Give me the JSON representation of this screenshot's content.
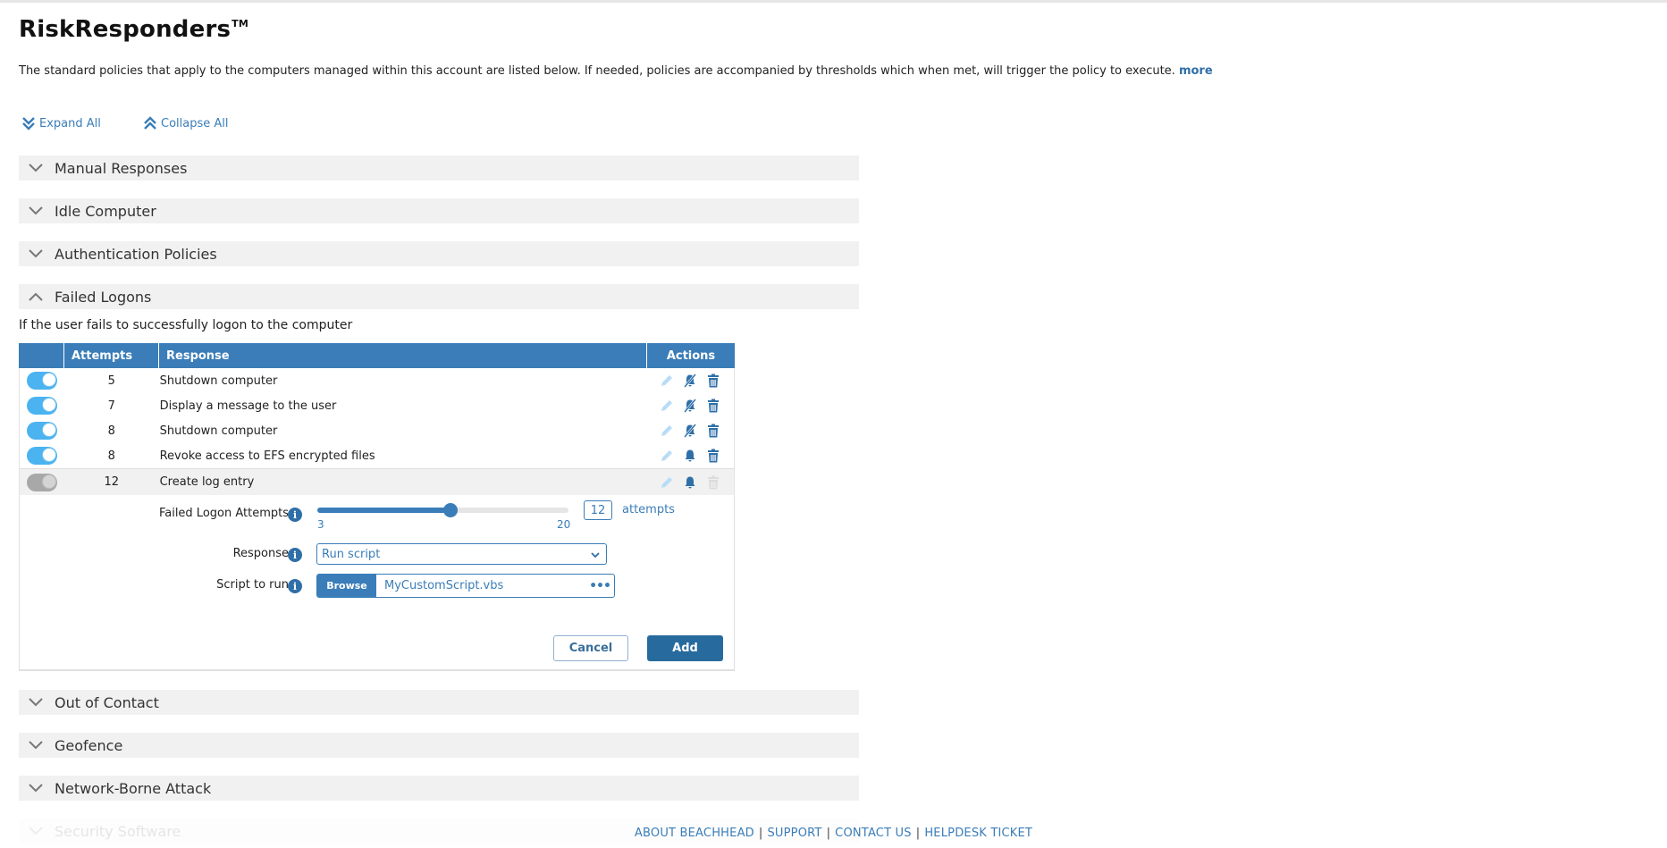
{
  "header": {
    "title": "RiskResponders",
    "trademark": "TM",
    "description": "The standard policies that apply to the computers managed within this account are listed below. If needed, policies are accompanied by thresholds which when met, will trigger the policy to execute.",
    "more_link": "more"
  },
  "controls": {
    "expand_all": "Expand All",
    "collapse_all": "Collapse All"
  },
  "sections": [
    {
      "label": "Manual Responses",
      "expanded": false
    },
    {
      "label": "Idle Computer",
      "expanded": false
    },
    {
      "label": "Authentication Policies",
      "expanded": false
    },
    {
      "label": "Failed Logons",
      "expanded": true
    },
    {
      "label": "Out of Contact",
      "expanded": false
    },
    {
      "label": "Geofence",
      "expanded": false
    },
    {
      "label": "Network-Borne Attack",
      "expanded": false
    },
    {
      "label": "Security Software",
      "expanded": false
    }
  ],
  "failed_logons": {
    "description": "If the user fails to successfully logon to the computer",
    "table": {
      "columns": [
        "",
        "Attempts",
        "Response",
        "Actions"
      ],
      "rows": [
        {
          "enabled": true,
          "attempts": "5",
          "response": "Shutdown computer",
          "notify": false
        },
        {
          "enabled": true,
          "attempts": "7",
          "response": "Display a message to the user",
          "notify": false
        },
        {
          "enabled": true,
          "attempts": "8",
          "response": "Shutdown computer",
          "notify": false
        },
        {
          "enabled": true,
          "attempts": "8",
          "response": "Revoke access to EFS encrypted files",
          "notify": true
        },
        {
          "enabled": false,
          "attempts": "12",
          "response": "Create log entry",
          "notify": true,
          "selected": true
        }
      ]
    },
    "form": {
      "attempts_label": "Failed Logon Attempts",
      "slider": {
        "min": 3,
        "max": 20,
        "value": 12,
        "min_label": "3",
        "max_label": "20"
      },
      "attempts_value": "12",
      "attempts_unit": "attempts",
      "response_label": "Response",
      "response_value": "Run script",
      "script_label": "Script to run",
      "browse_label": "Browse",
      "script_file": "MyCustomScript.vbs",
      "more_icon": "ellipsis",
      "cancel_label": "Cancel",
      "add_label": "Add"
    }
  },
  "footer": {
    "links": [
      "ABOUT BEACHHEAD",
      "SUPPORT",
      "CONTACT US",
      "HELPDESK TICKET"
    ],
    "separator": "|"
  },
  "colors": {
    "accent": "#3a7db8",
    "toggle_on": "#4ab3f0",
    "toggle_off": "#a8a8a8",
    "section_bg": "#f1f1f1",
    "add_button": "#276b9e"
  }
}
